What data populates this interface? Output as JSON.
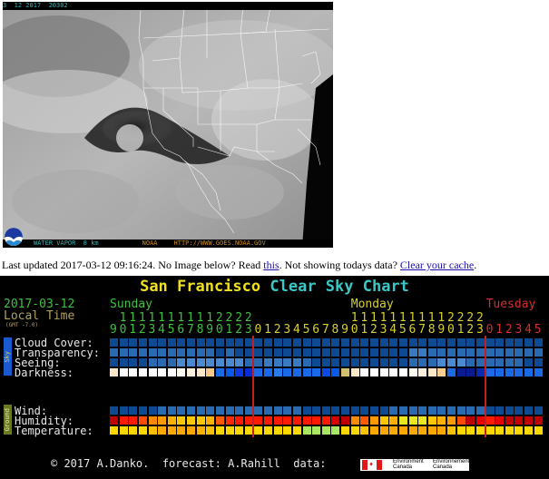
{
  "satellite": {
    "top_label": "3  12 2017  20302",
    "bottom_label_left": "WATER VAPOR  8 km",
    "bottom_label_agency": "NOAA",
    "bottom_label_url": "HTTP://WWW.GOES.NOAA.GOV",
    "logo": "noaa-logo"
  },
  "info": {
    "prefix": "Last updated 2017-03-12 09:16:24. No Image below? Read ",
    "link1": "this",
    "middle": ". Not showing todays data? ",
    "link2": "Clear your cache",
    "suffix": "."
  },
  "chart": {
    "title_city": "San Francisco",
    "title_name": "Clear Sky Chart",
    "date": "2017-03-12",
    "local_time": "Local Time",
    "gmt": "(GMT -7.0)",
    "days": [
      {
        "name": "Sunday",
        "color": "#40c040",
        "hours": [
          9,
          10,
          11,
          12,
          13,
          14,
          15,
          16,
          17,
          18,
          19,
          20,
          21,
          22,
          23
        ]
      },
      {
        "name": "Monday",
        "color": "#d8d030",
        "hours": [
          0,
          1,
          2,
          3,
          4,
          5,
          6,
          7,
          8,
          9,
          10,
          11,
          12,
          13,
          14,
          15,
          16,
          17,
          18,
          19,
          20,
          21,
          22,
          23
        ]
      },
      {
        "name": "Tuesday",
        "color": "#d03030",
        "hours": [
          0,
          1,
          2,
          3,
          4,
          5
        ]
      }
    ],
    "sections": [
      {
        "tag": "Sky",
        "tag_color": "#1a5ad0",
        "tag_text_color": "#e0d040"
      },
      {
        "tag": "Ground",
        "tag_color": "#6a7a20",
        "tag_text_color": "#e8e8c0"
      }
    ],
    "rows": [
      {
        "label": "Cloud Cover:",
        "colors": [
          "#0d4a92",
          "#0d4a92",
          "#0d4a92",
          "#0d4a92",
          "#0d4a92",
          "#0d4a92",
          "#0d4a92",
          "#0d4a92",
          "#0d4a92",
          "#0d4a92",
          "#0d4a92",
          "#0d4a92",
          "#0d4a92",
          "#0d4a92",
          "#0d4a92",
          "#0d4a92",
          "#0d4a92",
          "#0d4a92",
          "#0d4a92",
          "#0d4a92",
          "#0d4a92",
          "#0d4a92",
          "#0d4a92",
          "#0d4a92",
          "#0d4a92",
          "#0d4a92",
          "#0d4a92",
          "#0d4a92",
          "#0d4a92",
          "#0d4a92",
          "#0d4a92",
          "#0d4a92",
          "#0d4a92",
          "#0d4a92",
          "#0d4a92",
          "#0d4a92",
          "#0d4a92",
          "#0d4a92",
          "#0d4a92",
          "#0d4a92",
          "#0d4a92",
          "#0d4a92",
          "#0d4a92",
          "#0d4a92",
          "#0d4a92"
        ]
      },
      {
        "label": "Transparency:",
        "colors": [
          "#2a6ab0",
          "#2a6ab0",
          "#2a6ab0",
          "#2a6ab0",
          "#2a6ab0",
          "#2a6ab0",
          "#2a6ab0",
          "#2a6ab0",
          "#2a6ab0",
          "#2a6ab0",
          "#2a6ab0",
          "#0d4a92",
          "#2a6ab0",
          "#0d4a92",
          "#0d4a92",
          "#0d4a92",
          "#0d4a92",
          "#0d4a92",
          "#0d4a92",
          "#0d4a92",
          "#0d4a92",
          "#0d4a92",
          "#0d4a92",
          "#0d4a92",
          "#0d4a92",
          "#0d4a92",
          "#0d4a92",
          "#0d4a92",
          "#0d4a92",
          "#0d4a92",
          "#0d4a92",
          "#3a7ac0",
          "#3a7ac0",
          "#2a6ab0",
          "#2a6ab0",
          "#2a6ab0",
          "#2a6ab0",
          "#2a6ab0",
          "#2a6ab0",
          "#2a6ab0",
          "#2a6ab0",
          "#2a6ab0",
          "#2a6ab0",
          "#2a6ab0",
          "#2a6ab0"
        ]
      },
      {
        "label": "Seeing:",
        "colors": [
          "#0d4a92",
          "#0d4a92",
          "#0d4a92",
          "#0d4a92",
          "#2a6ab0",
          "#2a6ab0",
          "#2a6ab0",
          "#4a8ad0",
          "#4a8ad0",
          "#4a8ad0",
          "#4a8ad0",
          "#4a8ad0",
          "#4a8ad0",
          "#4a8ad0",
          "#2a6ab0",
          "#2a6ab0",
          "#3a7ac0",
          "#3a7ac0",
          "#3a7ac0",
          "#3a7ac0",
          "#2a6ab0",
          "#0d4a92",
          "#0d4a92",
          "#0d4a92",
          "#0d4a92",
          "#0d4a92",
          "#0d4a92",
          "#0d4a92",
          "#0d4a92",
          "#0d4a92",
          "#0d4a92",
          "#2a6ab0",
          "#2a6ab0",
          "#2a6ab0",
          "#4a8ad0",
          "#4a8ad0",
          "#4a8ad0",
          "#2a6ab0",
          "#2a6ab0",
          "#2a6ab0",
          "#2a6ab0",
          "#2a6ab0",
          "#2a6ab0",
          "#0d4a92",
          "#0d4a92"
        ]
      },
      {
        "label": "Darkness:",
        "colors": [
          "#fbe6c8",
          "#ffffff",
          "#ffffff",
          "#ffffff",
          "#ffffff",
          "#ffffff",
          "#ffffff",
          "#fffaf0",
          "#fbf0dc",
          "#fbe6c8",
          "#f7c88a",
          "#1a6ae8",
          "#0a5ae8",
          "#0a3ae0",
          "#0a2ad8",
          "#1a6ae8",
          "#1a6ae8",
          "#2a7ae8",
          "#1a6ae8",
          "#1a6ae8",
          "#1a6ae8",
          "#1a6ae8",
          "#0a4ae0",
          "#0a5ae8",
          "#d0c070",
          "#fbe6c8",
          "#ffffff",
          "#ffffff",
          "#ffffff",
          "#ffffff",
          "#ffffff",
          "#fffaf0",
          "#fbf0dc",
          "#fbe6c8",
          "#f7d090",
          "#1a6ae8",
          "#0a1a90",
          "#0a1a90",
          "#0a2ab0",
          "#1a6ae8",
          "#1a6ae8",
          "#1a6ae8",
          "#1a6ae8",
          "#1a6ae8",
          "#1a6ae8"
        ]
      },
      {
        "label": "Wind:",
        "colors": [
          "#0d4a92",
          "#0d4a92",
          "#0d4a92",
          "#0d4a92",
          "#0d4a92",
          "#2a6ab0",
          "#2a6ab0",
          "#2a6ab0",
          "#2a6ab0",
          "#2a6ab0",
          "#2a6ab0",
          "#2a6ab0",
          "#2a6ab0",
          "#2a6ab0",
          "#2a6ab0",
          "#2a6ab0",
          "#2a6ab0",
          "#2a6ab0",
          "#2a6ab0",
          "#2a6ab0",
          "#0d4a92",
          "#0d4a92",
          "#0d4a92",
          "#0d4a92",
          "#0d4a92",
          "#0d4a92",
          "#0d4a92",
          "#0d4a92",
          "#0d4a92",
          "#2a6ab0",
          "#2a6ab0",
          "#2a6ab0",
          "#2a6ab0",
          "#2a6ab0",
          "#2a6ab0",
          "#2a6ab0",
          "#2a6ab0",
          "#2a6ab0",
          "#2a6ab0",
          "#0d4a92",
          "#0d4a92",
          "#0d4a92",
          "#0d4a92",
          "#0d4a92",
          "#0d4a92"
        ]
      },
      {
        "label": "Humidity:",
        "colors": [
          "#c00000",
          "#ff1a00",
          "#ff1a00",
          "#ff4a00",
          "#ff8a00",
          "#ff9a00",
          "#ffb000",
          "#ffc800",
          "#ffc800",
          "#ffc800",
          "#ffb000",
          "#ff5a00",
          "#ff2a00",
          "#ff1a00",
          "#ff1a00",
          "#ff1a00",
          "#ff1a00",
          "#ff1a00",
          "#ff1a00",
          "#ff1a00",
          "#ff1a00",
          "#ff1a00",
          "#ff1a00",
          "#d80000",
          "#c00000",
          "#ff8a00",
          "#ff5a00",
          "#ff9a00",
          "#ffc800",
          "#ffb000",
          "#e8e820",
          "#e8e820",
          "#e8e820",
          "#ffc800",
          "#ffb000",
          "#ff9a00",
          "#ff4a00",
          "#c00000",
          "#e80000",
          "#ff1a00",
          "#e80000",
          "#c00000",
          "#c00000",
          "#c00000",
          "#c00000"
        ]
      },
      {
        "label": "Temperature:",
        "colors": [
          "#ffd800",
          "#ffd800",
          "#ffd800",
          "#ffd800",
          "#ffc000",
          "#ffa800",
          "#ffa800",
          "#ffa800",
          "#ffa800",
          "#ffb000",
          "#ffc000",
          "#ffd800",
          "#ffd800",
          "#ffd800",
          "#ffd800",
          "#ffd800",
          "#ffd800",
          "#ffd800",
          "#ffd800",
          "#ffd800",
          "#a8e860",
          "#a8e860",
          "#a8e860",
          "#a8e860",
          "#ffd800",
          "#ffd800",
          "#ffc000",
          "#ffa800",
          "#ffa800",
          "#ffa800",
          "#ffa800",
          "#ffa800",
          "#ffa800",
          "#ffa800",
          "#ffa800",
          "#ffc000",
          "#ffd800",
          "#ffd800",
          "#ffd800",
          "#ffd800",
          "#ffd800",
          "#ffd800",
          "#ffd800",
          "#ffd800",
          "#ffd800"
        ]
      }
    ],
    "footer": {
      "text": "© 2017 A.Danko.  forecast: A.Rahill  data:",
      "logo_en": "Environment\nCanada",
      "logo_fr": "Environnement\nCanada"
    }
  }
}
